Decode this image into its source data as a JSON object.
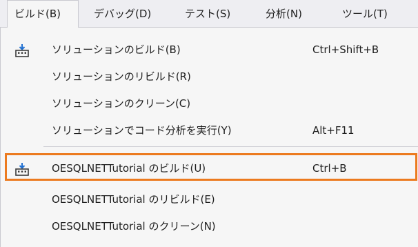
{
  "menubar": {
    "items": [
      {
        "label": "ビルド(B)"
      },
      {
        "label": "デバッグ(D)"
      },
      {
        "label": "テスト(S)"
      },
      {
        "label": "分析(N)"
      },
      {
        "label": "ツール(T)"
      }
    ]
  },
  "menu": {
    "items": [
      {
        "label": "ソリューションのビルド(B)",
        "shortcut": "Ctrl+Shift+B",
        "icon": "build-solution-icon"
      },
      {
        "label": "ソリューションのリビルド(R)",
        "shortcut": ""
      },
      {
        "label": "ソリューションのクリーン(C)",
        "shortcut": ""
      },
      {
        "label": "ソリューションでコード分析を実行(Y)",
        "shortcut": "Alt+F11"
      },
      {
        "label": "OESQLNETTutorial のビルド(U)",
        "shortcut": "Ctrl+B",
        "icon": "build-project-icon"
      },
      {
        "label": "OESQLNETTutorial のリビルド(E)",
        "shortcut": ""
      },
      {
        "label": "OESQLNETTutorial のクリーン(N)",
        "shortcut": ""
      }
    ]
  },
  "colors": {
    "highlight_border": "#ec7a1e",
    "icon_blue": "#1f6fd1",
    "icon_dark": "#3a3a3a"
  }
}
